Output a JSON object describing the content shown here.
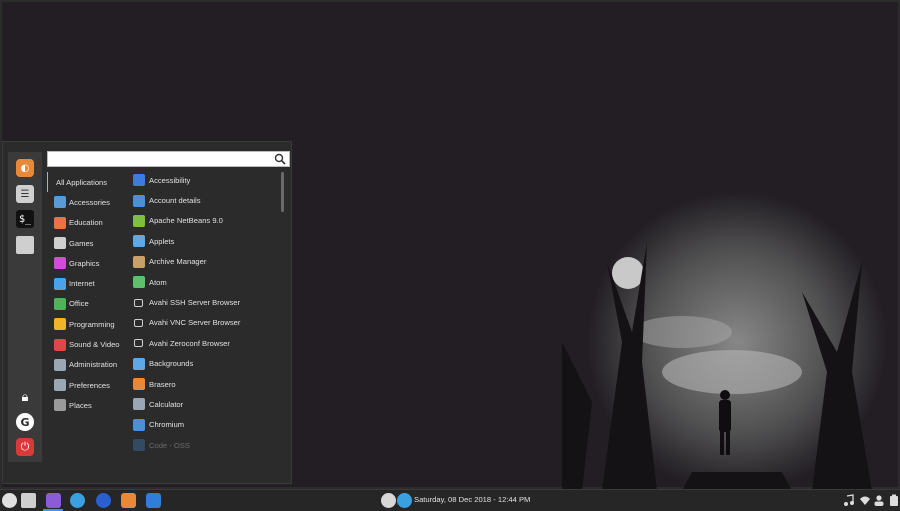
{
  "search": {
    "placeholder": "",
    "value": ""
  },
  "categories": [
    {
      "label": "All Applications",
      "icon": "none",
      "color": ""
    },
    {
      "label": "Accessories",
      "icon": "accessories-icon",
      "color": "#5b9bd5"
    },
    {
      "label": "Education",
      "icon": "education-icon",
      "color": "#e8734a"
    },
    {
      "label": "Games",
      "icon": "gamepad-icon",
      "color": "#cfcfcf"
    },
    {
      "label": "Graphics",
      "icon": "graphics-icon",
      "color": "#d04ed6"
    },
    {
      "label": "Internet",
      "icon": "internet-icon",
      "color": "#4aa3e8"
    },
    {
      "label": "Office",
      "icon": "office-icon",
      "color": "#4fb35a"
    },
    {
      "label": "Programming",
      "icon": "programming-icon",
      "color": "#f0b429"
    },
    {
      "label": "Sound & Video",
      "icon": "sound-video-icon",
      "color": "#e04747"
    },
    {
      "label": "Administration",
      "icon": "administration-icon",
      "color": "#9aa7b4"
    },
    {
      "label": "Preferences",
      "icon": "preferences-icon",
      "color": "#9aa7b4"
    },
    {
      "label": "Places",
      "icon": "folder-icon",
      "color": "#9a9a9a"
    }
  ],
  "apps": [
    {
      "label": "Accessibility",
      "icon": "accessibility-icon",
      "color": "#3d7be0"
    },
    {
      "label": "Account details",
      "icon": "account-icon",
      "color": "#4a90d9"
    },
    {
      "label": "Apache NetBeans 9.0",
      "icon": "netbeans-icon",
      "color": "#7fbf3f"
    },
    {
      "label": "Applets",
      "icon": "applets-icon",
      "color": "#5fa8e8"
    },
    {
      "label": "Archive Manager",
      "icon": "archive-icon",
      "color": "#c9a06a"
    },
    {
      "label": "Atom",
      "icon": "atom-icon",
      "color": "#5fbf6a"
    },
    {
      "label": "Avahi SSH Server Browser",
      "icon": "window-icon",
      "color": "#2b2b2b"
    },
    {
      "label": "Avahi VNC Server Browser",
      "icon": "window-icon",
      "color": "#2b2b2b"
    },
    {
      "label": "Avahi Zeroconf Browser",
      "icon": "window-icon",
      "color": "#2b2b2b"
    },
    {
      "label": "Backgrounds",
      "icon": "backgrounds-icon",
      "color": "#5fa8e8"
    },
    {
      "label": "Brasero",
      "icon": "brasero-icon",
      "color": "#e8893a"
    },
    {
      "label": "Calculator",
      "icon": "calculator-icon",
      "color": "#9aa7b4"
    },
    {
      "label": "Chromium",
      "icon": "chromium-icon",
      "color": "#4a90d9"
    },
    {
      "label": "Code - OSS",
      "icon": "code-icon",
      "color": "#3a6a9a"
    }
  ],
  "clock": "Saturday, 08 Dec 2018 - 12:44 PM"
}
